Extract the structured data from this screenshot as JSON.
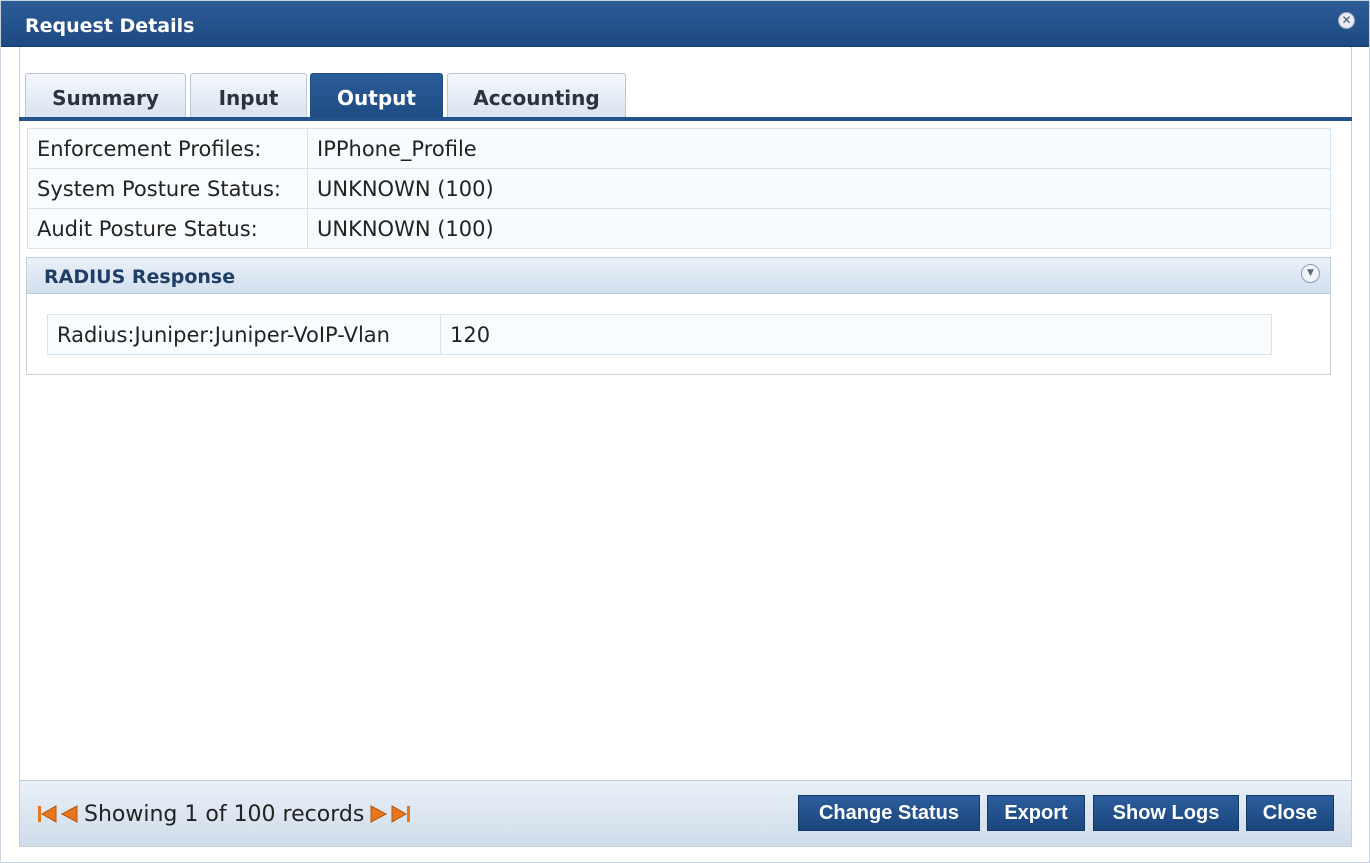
{
  "dialog": {
    "title": "Request Details",
    "close_icon": "close-icon"
  },
  "tabs": [
    {
      "label": "Summary",
      "active": false
    },
    {
      "label": "Input",
      "active": false
    },
    {
      "label": "Output",
      "active": true
    },
    {
      "label": "Accounting",
      "active": false
    }
  ],
  "output": {
    "rows": [
      {
        "key": "Enforcement Profiles:",
        "value": "IPPhone_Profile"
      },
      {
        "key": "System Posture Status:",
        "value": "UNKNOWN (100)"
      },
      {
        "key": "Audit Posture Status:",
        "value": "UNKNOWN (100)"
      }
    ]
  },
  "radius_response": {
    "title": "RADIUS Response",
    "rows": [
      {
        "key": "Radius:Juniper:Juniper-VoIP-Vlan",
        "value": "120"
      }
    ]
  },
  "footer": {
    "pager_text": "Showing 1 of 100 records",
    "buttons": {
      "change_status": "Change Status",
      "export": "Export",
      "show_logs": "Show Logs",
      "close": "Close"
    }
  },
  "colors": {
    "primary": "#1f4b83",
    "arrow": "#e8761c"
  }
}
